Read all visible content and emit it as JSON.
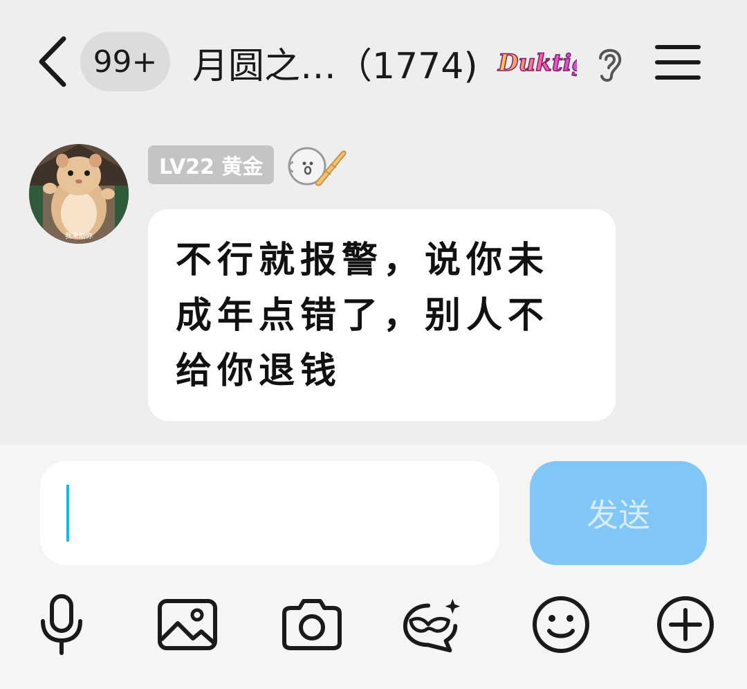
{
  "header": {
    "unread_count": "99+",
    "title": "月圆之…（1774)",
    "brand_badge_text": "Duktig",
    "icons": [
      "back-icon",
      "ear-icon",
      "menu-icon"
    ]
  },
  "message": {
    "level_badge": "LV22 黄金",
    "avatar_caption": "我来助你",
    "text": "不行就报警，说你未成年点错了，别人不给你退钱"
  },
  "composer": {
    "input_value": "",
    "input_placeholder": "",
    "send_label": "发送",
    "send_color": "#80c6f6",
    "caret_color": "#14b8f0"
  },
  "toolbar": {
    "icons": [
      "microphone-icon",
      "image-icon",
      "camera-icon",
      "ai-mask-icon",
      "emoji-icon",
      "plus-icon"
    ]
  }
}
